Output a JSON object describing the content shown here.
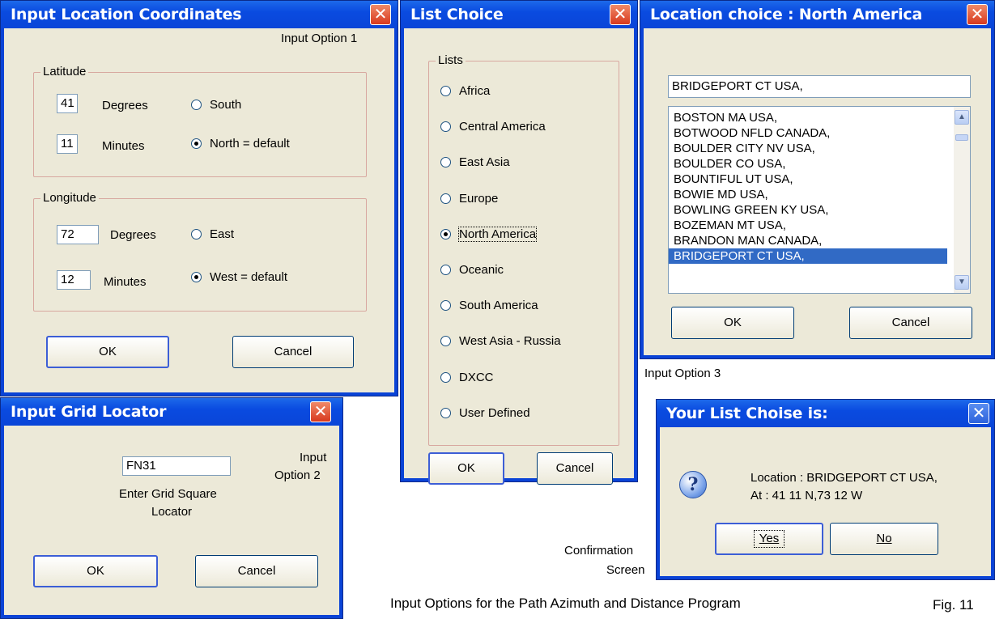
{
  "w1": {
    "title": "Input Location Coordinates",
    "option_label": "Input Option 1",
    "latitude": {
      "label": "Latitude",
      "degrees_value": "41",
      "degrees_label": "Degrees",
      "minutes_value": "11",
      "minutes_label": "Minutes",
      "south_label": "South",
      "north_label": "North = default"
    },
    "longitude": {
      "label": "Longitude",
      "degrees_value": "72",
      "degrees_label": "Degrees",
      "minutes_value": "12",
      "minutes_label": "Minutes",
      "east_label": "East",
      "west_label": "West = default"
    },
    "ok_label": "OK",
    "cancel_label": "Cancel"
  },
  "w2": {
    "title": "List Choice",
    "group_label": "Lists",
    "options": [
      "Africa",
      "Central America",
      "East Asia",
      "Europe",
      "North America",
      "Oceanic",
      "South America",
      "West Asia - Russia",
      "DXCC",
      "User Defined"
    ],
    "selected": "North America",
    "ok_label": "OK",
    "cancel_label": "Cancel"
  },
  "w3": {
    "title": "Location choice : North America",
    "current_value": "BRIDGEPORT CT USA,",
    "items": [
      "BOSTON MA USA,",
      "BOTWOOD NFLD CANADA,",
      "BOULDER CITY NV USA,",
      "BOULDER CO USA,",
      "BOUNTIFUL UT USA,",
      "BOWIE MD USA,",
      "BOWLING GREEN KY USA,",
      "BOZEMAN MT USA,",
      "BRANDON MAN CANADA,",
      "BRIDGEPORT CT USA,"
    ],
    "selected_item": "BRIDGEPORT CT USA,",
    "ok_label": "OK",
    "cancel_label": "Cancel"
  },
  "option3_label": "Input Option 3",
  "w4": {
    "title": "Input Grid Locator",
    "value": "FN31",
    "option_label_1": "Input",
    "option_label_2": "Option 2",
    "hint_1": "Enter Grid Square",
    "hint_2": "Locator",
    "ok_label": "OK",
    "cancel_label": "Cancel"
  },
  "w5": {
    "title": "Your List Choise is:",
    "line1": "Location : BRIDGEPORT CT USA,",
    "line2": "At : 41 11 N,73 12 W",
    "yes_label": "Yes",
    "no_label": "No"
  },
  "confirmation_1": "Confirmation",
  "confirmation_2": "Screen",
  "caption": "Input Options for the Path Azimuth and Distance Program",
  "fig_label": "Fig. 11",
  "colors": {
    "titlebar": "#0a4be0",
    "dialog_bg": "#ece9d8",
    "close_button": "#d8391e",
    "selection": "#316ac5"
  },
  "icons": {
    "close": "close-icon",
    "question": "question-icon",
    "scroll_up": "scroll-up-icon",
    "scroll_down": "scroll-down-icon"
  }
}
